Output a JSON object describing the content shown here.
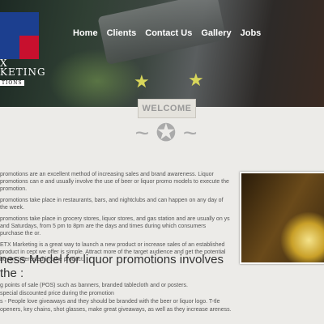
{
  "logo": {
    "line1": "X",
    "line2": "KETING",
    "line3": "TIONS"
  },
  "nav": [
    "Home",
    "Clients",
    "Contact Us",
    "Gallery",
    "Jobs"
  ],
  "welcome": "WELCOME",
  "paragraphs": [
    "promotions are an excellent method of increasing sales and brand awareness. Liquor promotions can e and usually involve the use of beer or liquor promo models to execute the promotion.",
    "promotions take place in restaurants, bars, and nightclubs and can happen on any day of the week.",
    "promotions take place in grocery stores, liquor stores, and gas station and are usually on ys and Saturdays, from 5 pm to 8pm are the days and times during which consumers purchase the or.",
    "ETX Marketing is a great way to launch a new product or increase sales of an established product in cept we offer is simple. Attract more of the target audience and get the potential buyers interested in t the product."
  ],
  "heading": "ness Model for liquor promotions involves the :",
  "list": [
    "g points of sale (POS) such as banners, branded tablecloth and or posters.",
    " special discounted price during the promotion",
    "s - People love giveaways and they should be branded with the beer or liquor logo. T-tle openers, key chains, shot glasses, make great giveaways, as well as they increase areness."
  ]
}
